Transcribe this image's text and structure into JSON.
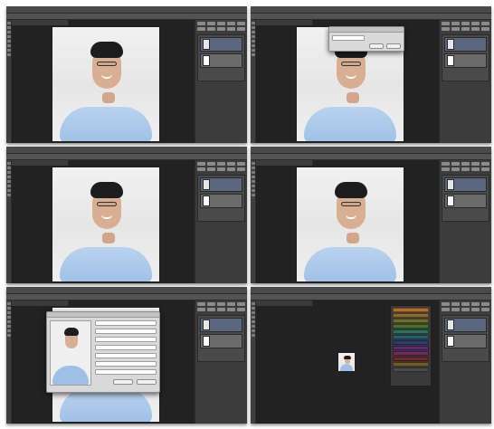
{
  "panels": [
    {
      "id": "panel-1"
    },
    {
      "id": "panel-2"
    },
    {
      "id": "panel-3"
    },
    {
      "id": "panel-4"
    },
    {
      "id": "panel-5"
    },
    {
      "id": "panel-6"
    }
  ],
  "colors": {
    "ui_dark": "#3b3b3b",
    "canvas_bg": "#222222",
    "panel_bg": "#3c3c3c",
    "layer_selected": "#5b677f",
    "dialog_bg": "#d9d9d9",
    "swatches": [
      "#b06d2c",
      "#8a6a2b",
      "#6c6c2f",
      "#4c6f2b",
      "#2b6f5d",
      "#2b5b6f",
      "#2b3f6f",
      "#5b2b6f",
      "#6f2b5b",
      "#6f2b2b",
      "#6f5b2b",
      "#4b4b4b"
    ]
  },
  "icons": {
    "toolbar": "tools-icon",
    "photo": "portrait-image",
    "layers": "layers-icon"
  }
}
